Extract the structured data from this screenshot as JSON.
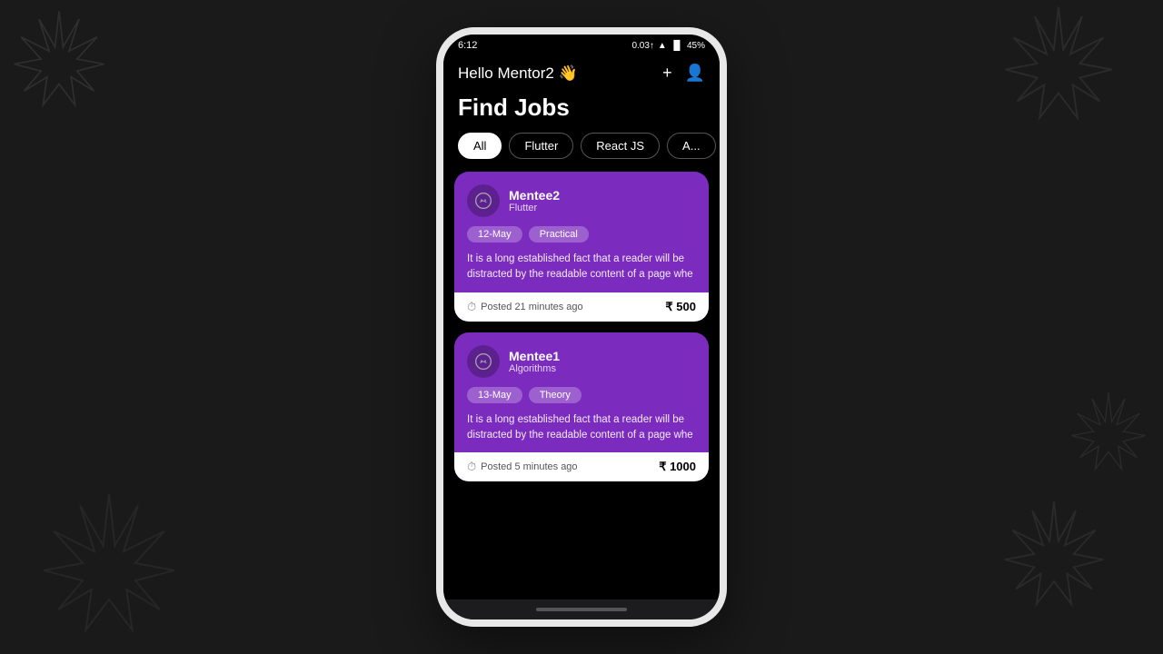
{
  "background": {
    "color": "#1a1a1a"
  },
  "statusBar": {
    "time": "6:12",
    "battery": "45%",
    "signal": "●●●"
  },
  "header": {
    "title": "Hello Mentor2 👋",
    "addIcon": "+",
    "profileIcon": "👤"
  },
  "pageTitle": "Find Jobs",
  "filters": [
    {
      "label": "All",
      "active": true
    },
    {
      "label": "Flutter",
      "active": false
    },
    {
      "label": "React JS",
      "active": false
    },
    {
      "label": "A...",
      "active": false
    }
  ],
  "jobs": [
    {
      "userName": "Mentee2",
      "userSub": "Flutter",
      "tags": [
        "12-May",
        "Practical"
      ],
      "description": "It is a long established fact that a reader will be distracted by the readable content of a page whe",
      "postedAgo": "Posted 21 minutes ago",
      "price": "₹ 500"
    },
    {
      "userName": "Mentee1",
      "userSub": "Algorithms",
      "tags": [
        "13-May",
        "Theory"
      ],
      "description": "It is a long established fact that a reader will be distracted by the readable content of a page whe",
      "postedAgo": "Posted 5 minutes ago",
      "price": "₹ 1000"
    }
  ]
}
